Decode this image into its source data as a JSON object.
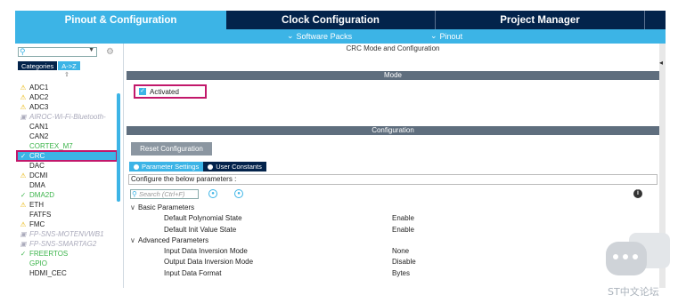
{
  "tabs": {
    "pinout": "Pinout & Configuration",
    "clock": "Clock Configuration",
    "project": "Project Manager"
  },
  "subbar": {
    "software_packs": "Software Packs",
    "pinout": "Pinout"
  },
  "left": {
    "category_tab": "Categories",
    "az_tab": "A->Z",
    "peripherals": [
      {
        "label": "ADC1",
        "status": "warning"
      },
      {
        "label": "ADC2",
        "status": "warning"
      },
      {
        "label": "ADC3",
        "status": "warning"
      },
      {
        "label": "AIROC-Wi-Fi-Bluetooth-",
        "status": "disabled"
      },
      {
        "label": "CAN1",
        "status": "none"
      },
      {
        "label": "CAN2",
        "status": "none"
      },
      {
        "label": "CORTEX_M7",
        "status": "green"
      },
      {
        "label": "CRC",
        "status": "selected"
      },
      {
        "label": "DAC",
        "status": "none"
      },
      {
        "label": "DCMI",
        "status": "warning"
      },
      {
        "label": "DMA",
        "status": "none"
      },
      {
        "label": "DMA2D",
        "status": "ok"
      },
      {
        "label": "ETH",
        "status": "warning"
      },
      {
        "label": "FATFS",
        "status": "none"
      },
      {
        "label": "FMC",
        "status": "warning"
      },
      {
        "label": "FP-SNS-MOTENVWB1",
        "status": "disabled"
      },
      {
        "label": "FP-SNS-SMARTAG2",
        "status": "disabled"
      },
      {
        "label": "FREERTOS",
        "status": "ok"
      },
      {
        "label": "GPIO",
        "status": "green"
      },
      {
        "label": "HDMI_CEC",
        "status": "none"
      }
    ]
  },
  "right": {
    "title": "CRC Mode and Configuration",
    "mode_header": "Mode",
    "activated_label": "Activated",
    "config_header": "Configuration",
    "reset_button": "Reset Configuration",
    "tab_parameter": "Parameter Settings",
    "tab_user": "User Constants",
    "configure_label": "Configure the below parameters :",
    "search_placeholder": "Search (Ctrl+F)",
    "groups": [
      {
        "name": "Basic Parameters",
        "params": [
          {
            "name": "Default Polynomial State",
            "value": "Enable"
          },
          {
            "name": "Default Init Value State",
            "value": "Enable"
          }
        ]
      },
      {
        "name": "Advanced Parameters",
        "params": [
          {
            "name": "Input Data Inversion Mode",
            "value": "None"
          },
          {
            "name": "Output Data Inversion Mode",
            "value": "Disable"
          },
          {
            "name": "Input Data Format",
            "value": "Bytes"
          }
        ]
      }
    ]
  },
  "watermark": "ST中文论坛",
  "colors": {
    "accent": "#3cb4e6",
    "dark_navy": "#03234b",
    "section_header": "#5f6e7e",
    "highlight": "#c2186b",
    "warning": "#e8b400",
    "ok": "#3cb44b"
  }
}
